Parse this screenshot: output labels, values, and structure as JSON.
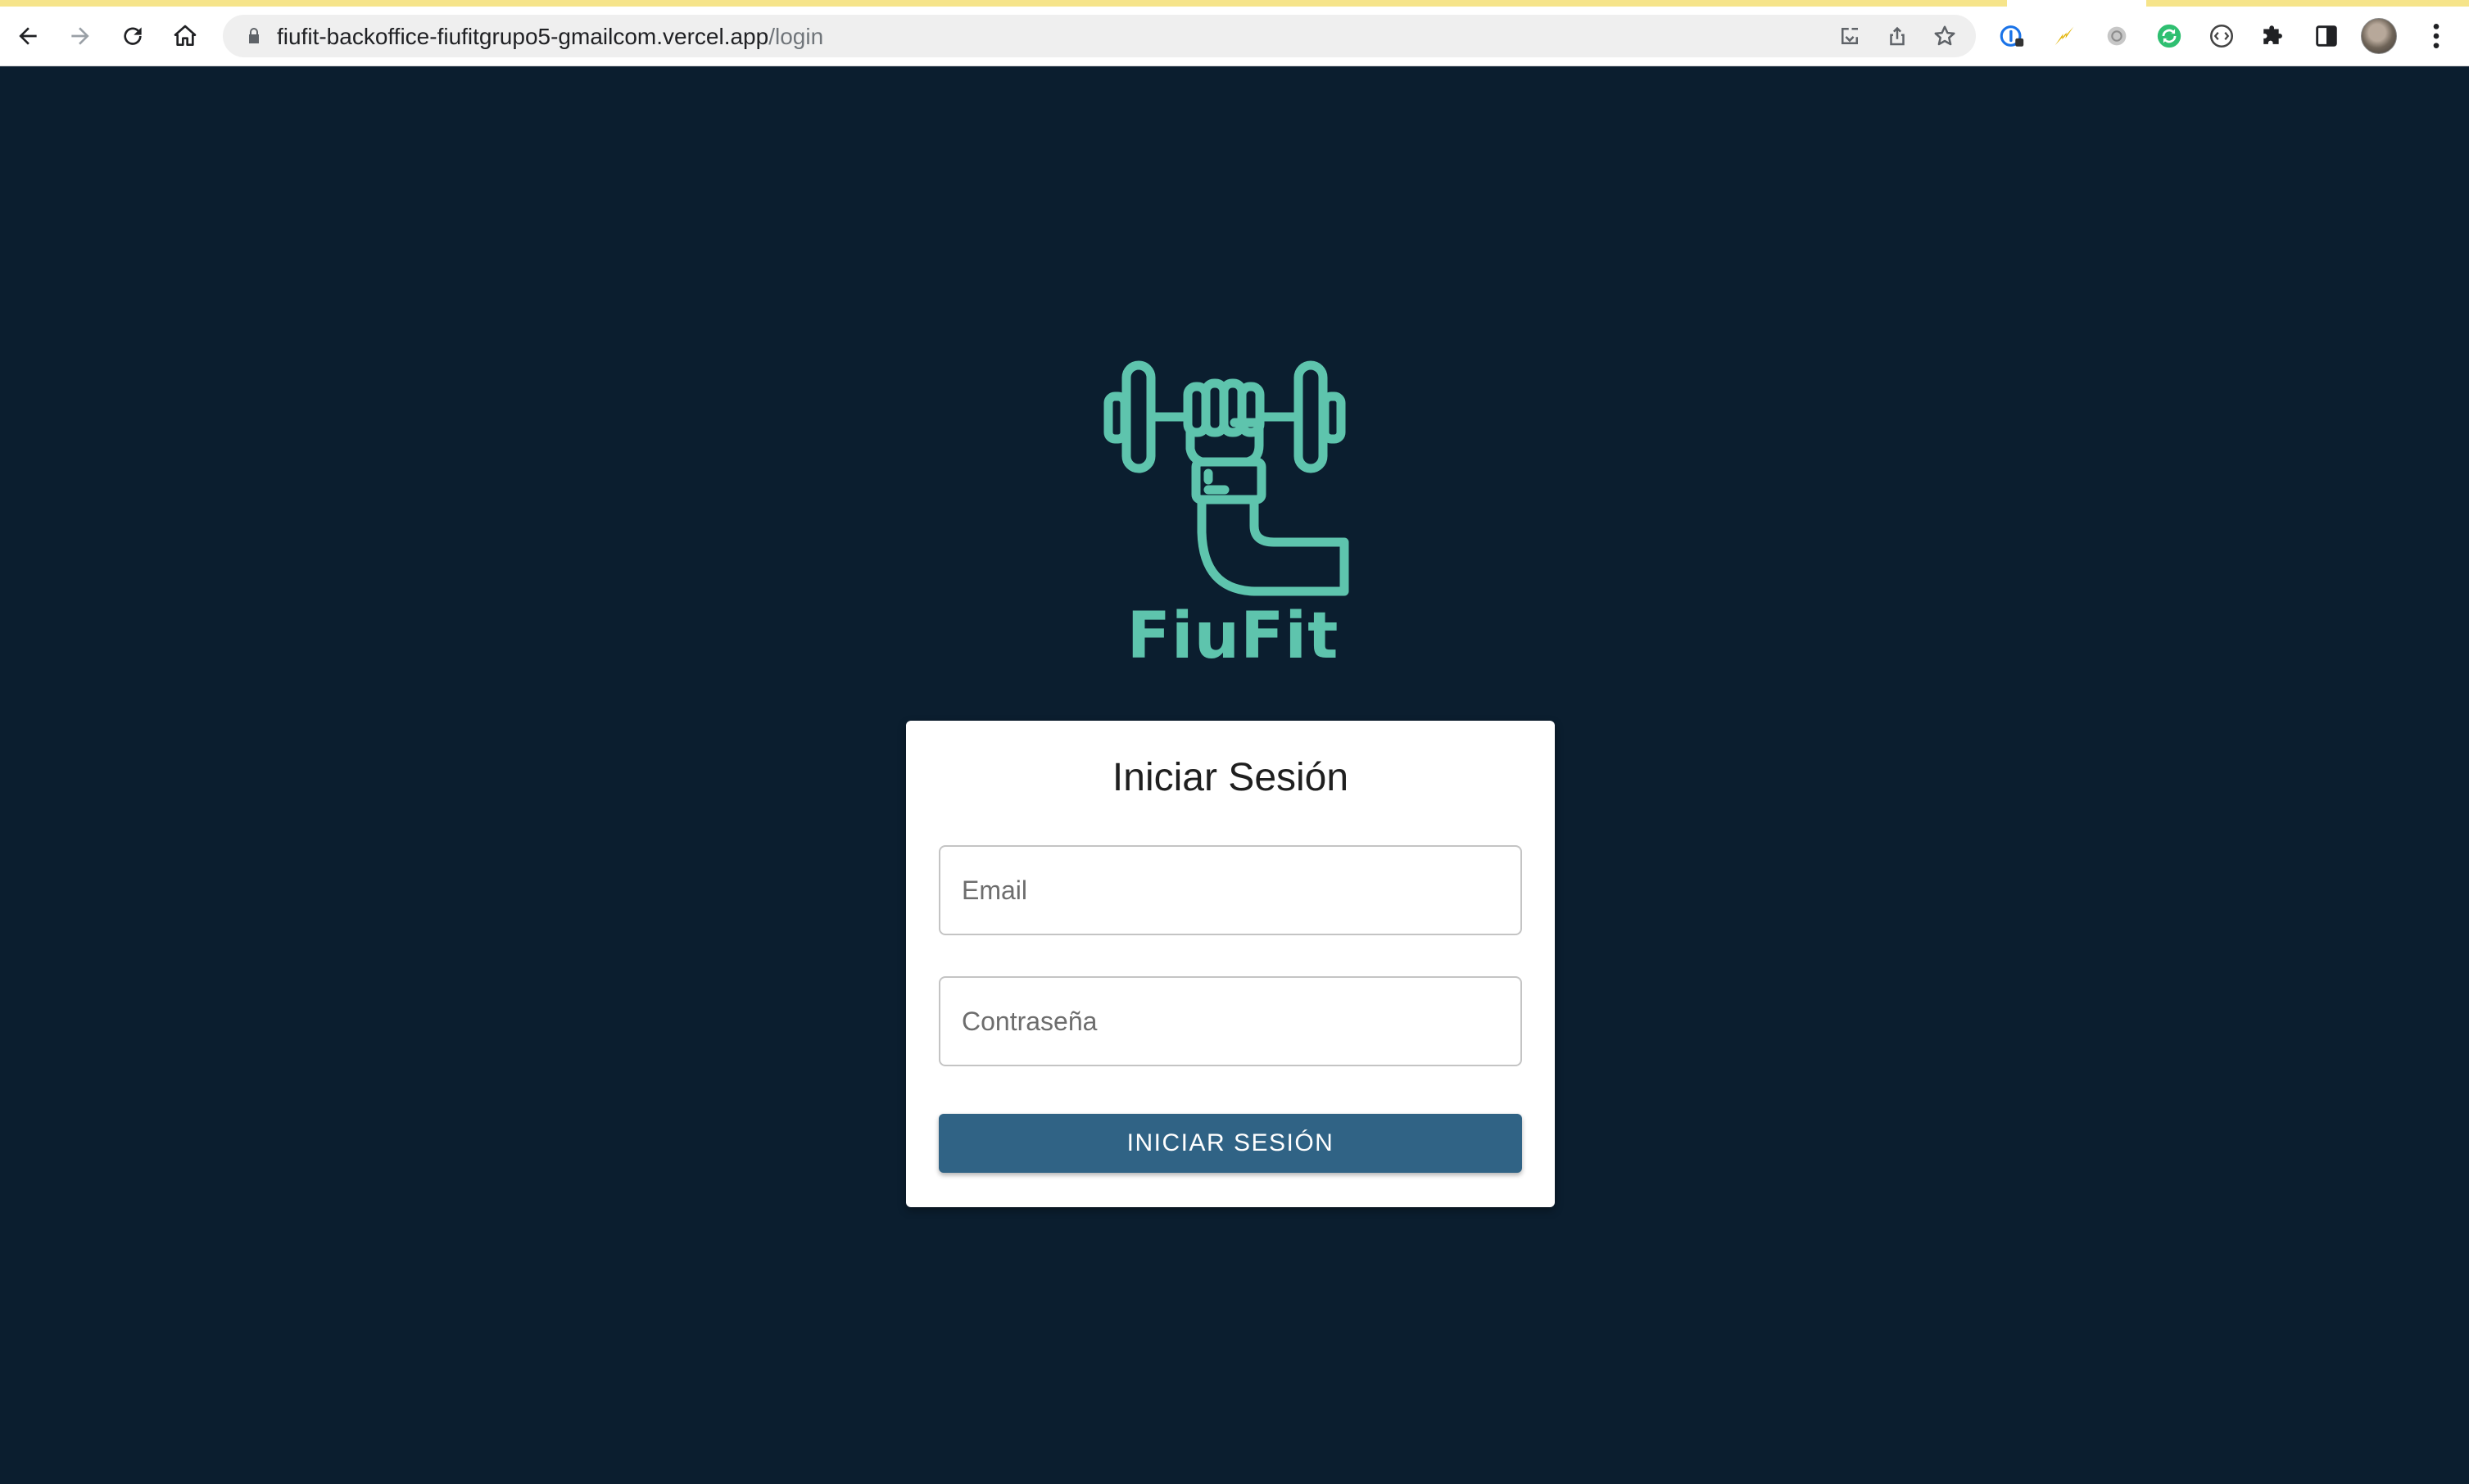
{
  "browser": {
    "url_host": "fiufit-backoffice-fiufitgrupo5-gmailcom.vercel.app",
    "url_path": "/login",
    "icons": {
      "back": "arrow-left-icon",
      "forward": "arrow-right-icon",
      "reload": "reload-icon",
      "home": "home-icon",
      "lock": "lock-icon",
      "install": "install-app-icon",
      "share": "share-icon",
      "bookmark": "star-icon",
      "extensions": [
        "onepassword-extension-icon",
        "lightning-extension-icon",
        "circle-extension-icon",
        "green-refresh-extension-icon",
        "code-extension-icon",
        "puzzle-extensions-icon",
        "side-panel-icon"
      ],
      "profile": "profile-avatar",
      "menu": "kebab-menu-icon"
    },
    "accent_color": "#f6e48a"
  },
  "page": {
    "background_color": "#0b1e2f",
    "logo": {
      "text": "FiuFit",
      "color": "#5ec4ad"
    },
    "login_card": {
      "title": "Iniciar Sesión",
      "email_placeholder": "Email",
      "password_placeholder": "Contraseña",
      "submit_label": "INICIAR SESIÓN",
      "button_color": "#306385"
    }
  }
}
